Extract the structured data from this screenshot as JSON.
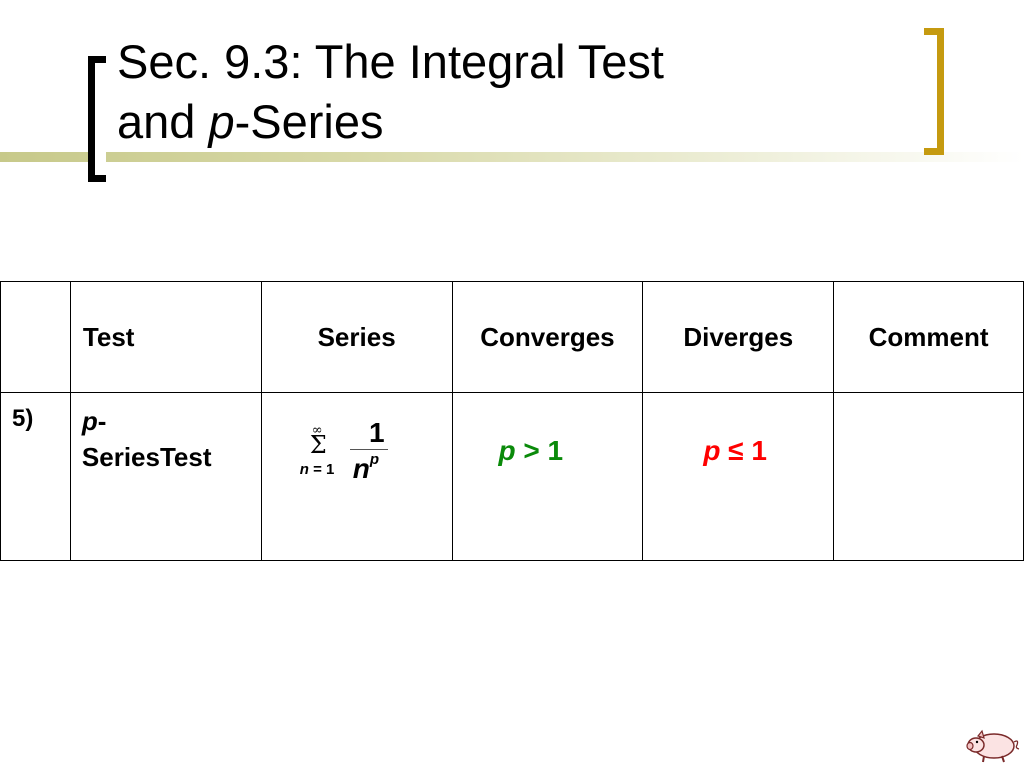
{
  "slide": {
    "title_line1": "Sec. 9.3:  The Integral Test",
    "title_line2_prefix": "and ",
    "title_line2_italic": "p",
    "title_line2_suffix": "-Series",
    "accent_color": "#c59a10"
  },
  "table": {
    "headers": [
      "",
      "Test",
      "Series",
      "Converges",
      "Diverges",
      "Comment"
    ],
    "row": {
      "number": "5)",
      "test_italic": "p",
      "test_dash": "-",
      "test_rest": "SeriesTest",
      "series": {
        "sum_symbol": "Σ",
        "upper_limit": "∞",
        "index_var": "n",
        "index_eq": " = 1",
        "numerator": "1",
        "denominator_base": "n",
        "denominator_exp": "p"
      },
      "converges": {
        "var": "p",
        "rest": " > 1",
        "color": "#0a8a0a"
      },
      "diverges": {
        "var": "p",
        "rest": " ≤ 1",
        "color": "#ff0000"
      },
      "comment": ""
    }
  },
  "footer_icon": "pig-icon"
}
